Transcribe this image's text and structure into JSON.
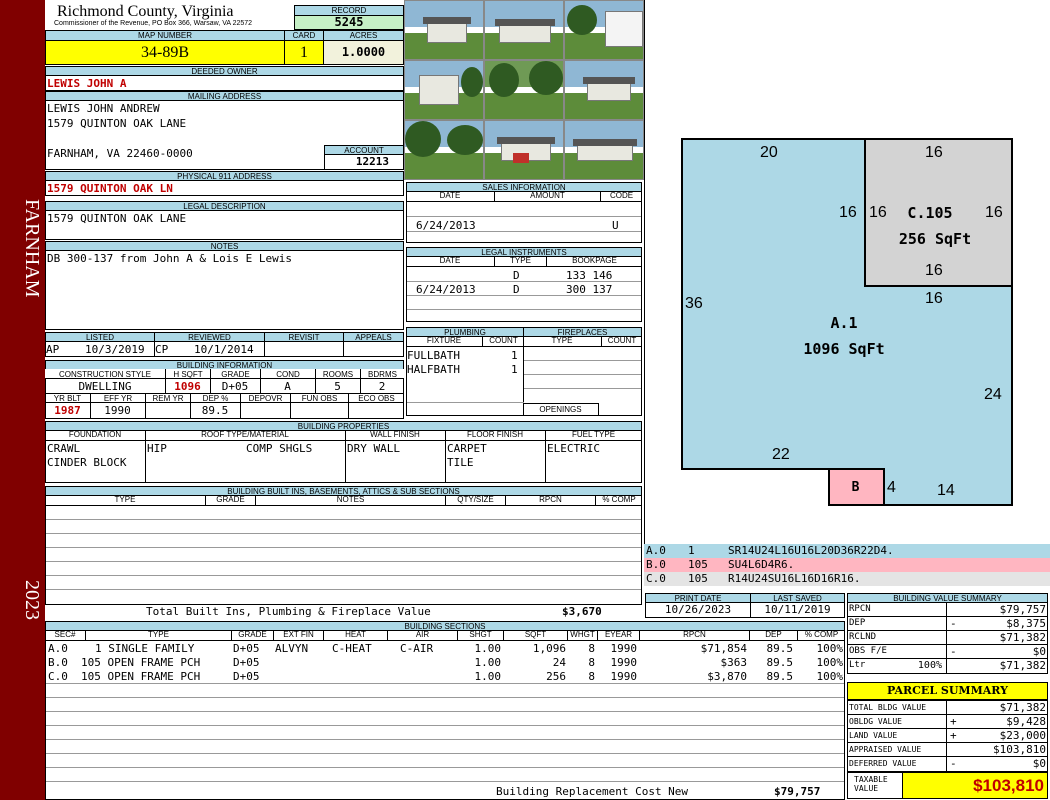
{
  "side": {
    "town": "FARNHAM",
    "year": "2023"
  },
  "header": {
    "county": "Richmond County, Virginia",
    "commissioner": "Commissioner of the Revenue, PO Box 366, Warsaw, VA 22572"
  },
  "record": {
    "label": "RECORD",
    "value": "5245"
  },
  "map": {
    "label": "MAP NUMBER",
    "value": "34-89B"
  },
  "card": {
    "label": "CARD",
    "value": "1"
  },
  "acres": {
    "label": "ACRES",
    "value": "1.0000"
  },
  "deeded": {
    "label": "DEEDED OWNER",
    "value": "LEWIS JOHN A"
  },
  "mailing": {
    "label": "MAILING ADDRESS",
    "line1": "LEWIS JOHN ANDREW",
    "line2": "1579 QUINTON OAK LANE",
    "line3": "FARNHAM, VA 22460-0000"
  },
  "account": {
    "label": "ACCOUNT",
    "value": "12213"
  },
  "physical": {
    "label": "PHYSICAL 911 ADDRESS",
    "value": "1579 QUINTON OAK LN"
  },
  "legal": {
    "label": "LEGAL DESCRIPTION",
    "value": "1579 QUINTON OAK LANE"
  },
  "notes": {
    "label": "NOTES",
    "value": "DB 300-137 from John A & Lois E Lewis"
  },
  "sales": {
    "label": "SALES INFORMATION",
    "cols": [
      "DATE",
      "AMOUNT",
      "CODE"
    ],
    "rows": [
      {
        "date": "6/24/2013",
        "amount": "",
        "code": "U"
      }
    ]
  },
  "legal_instr": {
    "label": "LEGAL INSTRUMENTS",
    "cols": [
      "DATE",
      "TYPE",
      "BOOKPAGE"
    ],
    "rows": [
      {
        "date": "",
        "type": "D",
        "book": "133 146"
      },
      {
        "date": "6/24/2013",
        "type": "D",
        "book": "300 137"
      }
    ]
  },
  "listed": {
    "labels": [
      "LISTED",
      "REVIEWED",
      "REVISIT",
      "APPEALS"
    ],
    "listed_by": "AP",
    "listed_date": "10/3/2019",
    "reviewed_by": "CP",
    "reviewed_date": "10/1/2014"
  },
  "building_info": {
    "label": "BUILDING INFORMATION",
    "cols": [
      "CONSTRUCTION STYLE",
      "H SQFT",
      "GRADE",
      "COND",
      "ROOMS",
      "BDRMS"
    ],
    "values": [
      "DWELLING",
      "1096",
      "D+05",
      "A",
      "5",
      "2"
    ],
    "cols2": [
      "YR BLT",
      "EFF YR",
      "REM YR",
      "DEP %",
      "DEPOVR",
      "FUN OBS",
      "ECO OBS"
    ],
    "values2": [
      "1987",
      "1990",
      "",
      "89.5",
      "",
      "",
      ""
    ]
  },
  "plumbing": {
    "label": "PLUMBING",
    "cols": [
      "FIXTURE",
      "COUNT"
    ],
    "rows": [
      {
        "fixture": "FULLBATH",
        "count": "1"
      },
      {
        "fixture": "HALFBATH",
        "count": "1"
      }
    ]
  },
  "fireplaces": {
    "label": "FIREPLACES",
    "cols": [
      "TYPE",
      "COUNT"
    ],
    "openings": "OPENINGS"
  },
  "props": {
    "label": "BUILDING PROPERTIES",
    "cols": [
      "FOUNDATION",
      "ROOF TYPE/MATERIAL",
      "WALL FINISH",
      "FLOOR FINISH",
      "FUEL TYPE"
    ],
    "foundation1": "CRAWL",
    "foundation2": "CINDER BLOCK",
    "roof_type": "HIP",
    "roof_mat": "COMP SHGLS",
    "wall": "DRY WALL",
    "floor1": "CARPET",
    "floor2": "TILE",
    "fuel": "ELECTRIC"
  },
  "builtins": {
    "label": "BUILDING BUILT INS, BASEMENTS, ATTICS & SUB SECTIONS",
    "cols": [
      "TYPE",
      "GRADE",
      "NOTES",
      "QTY/SIZE",
      "RPCN",
      "% COMP"
    ],
    "total_label": "Total Built Ins, Plumbing & Fireplace Value",
    "total": "$3,670"
  },
  "dates": {
    "print_label": "PRINT DATE",
    "print": "10/26/2023",
    "saved_label": "LAST SAVED",
    "saved": "10/11/2019"
  },
  "sketch": {
    "dims": {
      "a_top": "20",
      "c_top": "16",
      "c_left_outer": "16",
      "c_left_inner": "16",
      "c_right": "16",
      "c_bottom": "16",
      "a_under_c": "16",
      "a_left": "36",
      "a_right": "24",
      "a_bottom": "22",
      "b_right": "4",
      "a_bottom_right": "14"
    },
    "a_name": "A.1",
    "a_area": "1096 SqFt",
    "c_name": "C.105",
    "c_area": "256 SqFt",
    "b_name": "B"
  },
  "sketch_legend": [
    {
      "sec": "A.0",
      "code": "1",
      "path": "SR14U24L16U16L20D36R22D4."
    },
    {
      "sec": "B.0",
      "code": "105",
      "path": "SU4L6D4R6."
    },
    {
      "sec": "C.0",
      "code": "105",
      "path": "R14U24SU16L16D16R16."
    }
  ],
  "sections": {
    "label": "BUILDING SECTIONS",
    "cols": [
      "SEC#",
      "TYPE",
      "GRADE",
      "EXT FIN",
      "HEAT",
      "AIR",
      "SHGT",
      "SQFT",
      "WHGT",
      "EYEAR",
      "RPCN",
      "DEP",
      "% COMP"
    ],
    "rows": [
      {
        "sec": "A.0",
        "type": "1 SINGLE FAMILY",
        "grade": "D+05",
        "ext": "ALVYN",
        "heat": "C-HEAT",
        "air": "C-AIR",
        "shgt": "1.00",
        "sqft": "1,096",
        "whgt": "8",
        "eyear": "1990",
        "rpcn": "$71,854",
        "dep": "89.5",
        "comp": "100%"
      },
      {
        "sec": "B.0",
        "type": "105 OPEN FRAME PCH",
        "grade": "D+05",
        "ext": "",
        "heat": "",
        "air": "",
        "shgt": "1.00",
        "sqft": "24",
        "whgt": "8",
        "eyear": "1990",
        "rpcn": "$363",
        "dep": "89.5",
        "comp": "100%"
      },
      {
        "sec": "C.0",
        "type": "105 OPEN FRAME PCH",
        "grade": "D+05",
        "ext": "",
        "heat": "",
        "air": "",
        "shgt": "1.00",
        "sqft": "256",
        "whgt": "8",
        "eyear": "1990",
        "rpcn": "$3,870",
        "dep": "89.5",
        "comp": "100%"
      }
    ],
    "replacement_label": "Building Replacement Cost New",
    "replacement": "$79,757"
  },
  "value_summary": {
    "label": "BUILDING VALUE SUMMARY",
    "rows": [
      {
        "label": "RPCN",
        "sign": "",
        "value": "$79,757"
      },
      {
        "label": "DEP",
        "sign": "-",
        "value": "$8,375"
      },
      {
        "label": "RCLND",
        "sign": "",
        "value": "$71,382"
      },
      {
        "label": "OBS F/E",
        "sign": "-",
        "value": "$0"
      },
      {
        "label": "Ltr",
        "pct": "100%",
        "sign": "",
        "value": "$71,382"
      }
    ]
  },
  "parcel": {
    "label": "PARCEL SUMMARY",
    "rows": [
      {
        "label": "TOTAL BLDG VALUE",
        "sign": "",
        "value": "$71,382"
      },
      {
        "label": "OBLDG VALUE",
        "sign": "+",
        "value": "$9,428"
      },
      {
        "label": "LAND VALUE",
        "sign": "+",
        "value": "$23,000"
      },
      {
        "label": "APPRAISED VALUE",
        "sign": "",
        "value": "$103,810"
      },
      {
        "label": "DEFERRED VALUE",
        "sign": "-",
        "value": "$0"
      }
    ],
    "taxable_label1": "TAXABLE",
    "taxable_label2": "VALUE",
    "taxable": "$103,810"
  }
}
